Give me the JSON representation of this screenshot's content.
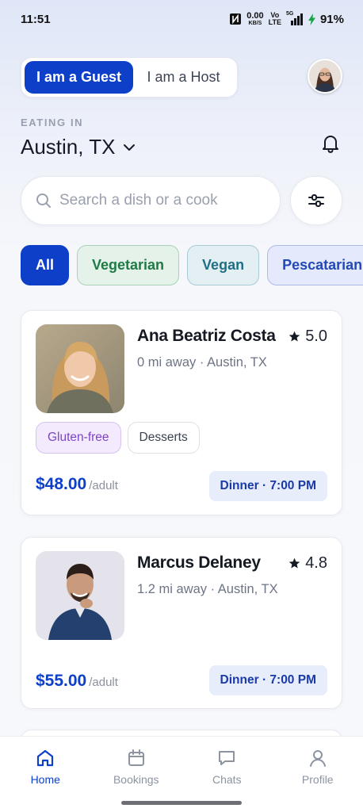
{
  "status_bar": {
    "time": "11:51",
    "net_speed": "0.00",
    "net_unit": "KB/S",
    "volte_top": "Vo",
    "volte_bottom": "LTE",
    "signal_label": "5G",
    "battery": "91%"
  },
  "mode_toggle": {
    "guest_label": "I am a Guest",
    "host_label": "I am a Host",
    "active": "guest"
  },
  "location": {
    "label": "EATING IN",
    "city": "Austin, TX"
  },
  "search": {
    "placeholder": "Search a dish or a cook"
  },
  "chips": [
    {
      "label": "All",
      "active": true
    },
    {
      "label": "Vegetarian",
      "active": false
    },
    {
      "label": "Vegan",
      "active": false
    },
    {
      "label": "Pescatarian",
      "active": false
    }
  ],
  "cooks": [
    {
      "name": "Ana Beatriz Costa",
      "rating": "5.0",
      "distance": "0 mi away · Austin, TX",
      "tags": [
        "Gluten-free",
        "Desserts"
      ],
      "price": "$48.00",
      "per": "/adult",
      "meal": "Dinner · 7:00 PM"
    },
    {
      "name": "Marcus Delaney",
      "rating": "4.8",
      "distance": "1.2 mi away · Austin, TX",
      "tags": [],
      "price": "$55.00",
      "per": "/adult",
      "meal": "Dinner · 7:00 PM"
    }
  ],
  "tab_bar": [
    {
      "label": "Home",
      "icon": "home-icon",
      "active": true
    },
    {
      "label": "Bookings",
      "icon": "calendar-icon",
      "active": false
    },
    {
      "label": "Chats",
      "icon": "chat-icon",
      "active": false
    },
    {
      "label": "Profile",
      "icon": "profile-icon",
      "active": false
    }
  ],
  "colors": {
    "primary": "#0d3fc9",
    "vegetarian": "#1f7a45",
    "vegan": "#1f6f86",
    "pescatarian": "#2348b8",
    "gluten_free": "#7c45c4"
  }
}
